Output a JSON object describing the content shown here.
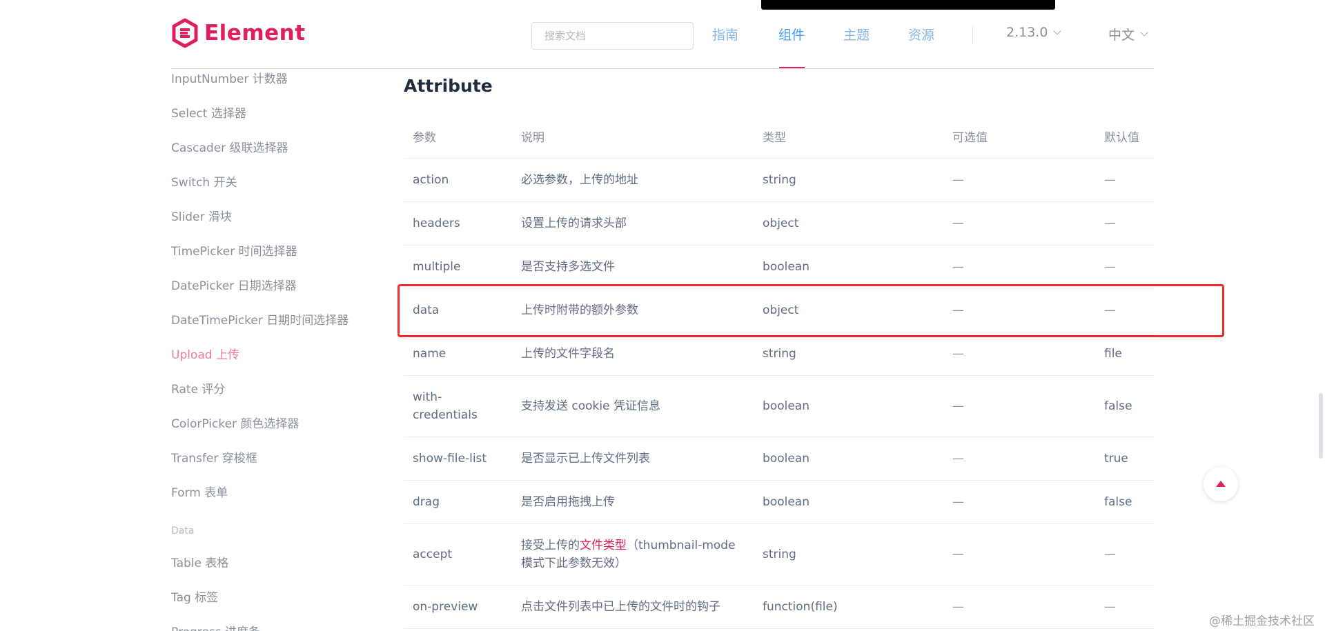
{
  "header": {
    "logo_text": "Element",
    "search_placeholder": "搜索文档",
    "nav": [
      "指南",
      "组件",
      "主题",
      "资源"
    ],
    "version": "2.13.0",
    "language": "中文"
  },
  "sidebar": {
    "items_top": [
      "InputNumber 计数器",
      "Select 选择器",
      "Cascader 级联选择器",
      "Switch 开关",
      "Slider 滑块",
      "TimePicker 时间选择器",
      "DatePicker 日期选择器",
      "DateTimePicker 日期时间选择器",
      "Upload 上传",
      "Rate 评分",
      "ColorPicker 颜色选择器",
      "Transfer 穿梭框",
      "Form 表单"
    ],
    "group_label": "Data",
    "items_bottom": [
      "Table 表格",
      "Tag 标签",
      "Progress 进度条"
    ]
  },
  "main": {
    "section_title": "Attribute",
    "table": {
      "headers": [
        "参数",
        "说明",
        "类型",
        "可选值",
        "默认值"
      ],
      "rows": [
        [
          "action",
          "必选参数，上传的地址",
          "string",
          "—",
          "—"
        ],
        [
          "headers",
          "设置上传的请求头部",
          "object",
          "—",
          "—"
        ],
        [
          "multiple",
          "是否支持多选文件",
          "boolean",
          "—",
          "—"
        ],
        [
          "data",
          "上传时附带的额外参数",
          "object",
          "—",
          "—"
        ],
        [
          "name",
          "上传的文件字段名",
          "string",
          "—",
          "file"
        ],
        [
          "with-credentials",
          "支持发送 cookie 凭证信息",
          "boolean",
          "—",
          "false"
        ],
        [
          "show-file-list",
          "是否显示已上传文件列表",
          "boolean",
          "—",
          "true"
        ],
        [
          "drag",
          "是否启用拖拽上传",
          "boolean",
          "—",
          "false"
        ],
        [
          "accept",
          "",
          "string",
          "—",
          "—"
        ],
        [
          "on-preview",
          "点击文件列表中已上传的文件时的钩子",
          "function(file)",
          "—",
          "—"
        ]
      ],
      "accept_desc": {
        "prefix": "接受上传的",
        "link": "文件类型",
        "suffix": "（thumbnail-mode 模式下此参数无效）"
      }
    }
  },
  "watermark": "@稀土掘金技术社区",
  "colors": {
    "brand": "#e0205a",
    "nav_link": "#85b7e6",
    "nav_active": "#409eff",
    "sidebar_active": "#ef7aa0",
    "highlight_box": "#ee2a2a"
  }
}
